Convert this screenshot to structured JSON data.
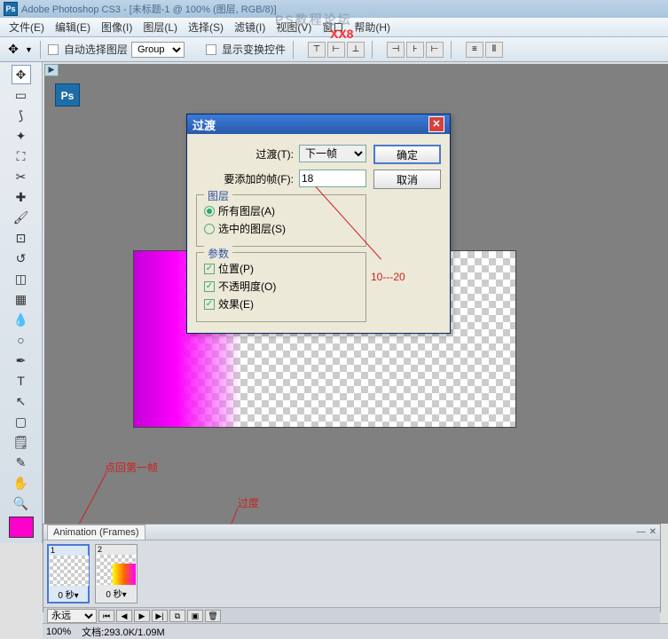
{
  "app": {
    "title": "Adobe Photoshop CS3 - [未标题-1 @ 100% (图层, RGB/8)]"
  },
  "menu": {
    "file": "文件(E)",
    "edit": "编辑(E)",
    "image": "图像(I)",
    "layer": "图层(L)",
    "select": "选择(S)",
    "filter": "滤镜(I)",
    "view": "视图(V)",
    "window": "窗口",
    "help": "帮助(H)"
  },
  "optbar": {
    "auto_select": "自动选择图层",
    "group_value": "Group",
    "show_transform": "显示变换控件"
  },
  "dialog": {
    "title": "过渡",
    "ok": "确定",
    "cancel": "取消",
    "tween_label": "过渡(T):",
    "tween_value": "下一帧",
    "frames_label": "要添加的帧(F):",
    "frames_value": "18",
    "layers": {
      "legend": "图层",
      "all": "所有图层(A)",
      "selected": "选中的图层(S)"
    },
    "params": {
      "legend": "参数",
      "position": "位置(P)",
      "opacity": "不透明度(O)",
      "effects": "效果(E)"
    }
  },
  "annotations": {
    "range": "10---20",
    "back_first": "点回第一帧",
    "tween": "过度"
  },
  "animation": {
    "title": "Animation (Frames)",
    "frames": [
      {
        "num": "1",
        "time": "0 秒"
      },
      {
        "num": "2",
        "time": "0 秒"
      }
    ],
    "loop": "永远"
  },
  "status": {
    "zoom": "100%",
    "doc": "文档:293.0K/1.09M"
  },
  "watermark": {
    "top": "PS教程论坛",
    "xxs": "XX8"
  }
}
